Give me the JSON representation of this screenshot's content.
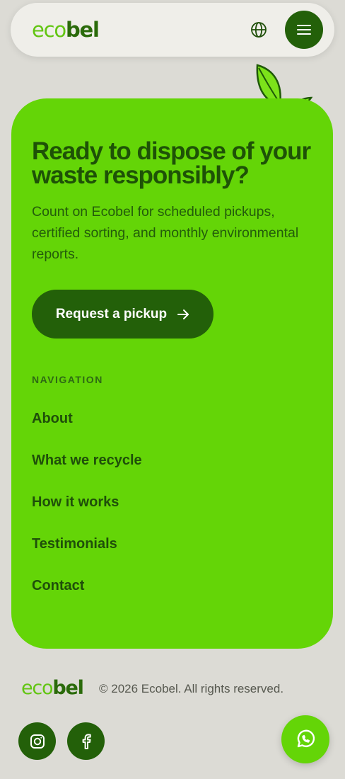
{
  "header": {
    "logo_left": "eco",
    "logo_right": "bel",
    "icons": {
      "language": "globe-icon",
      "menu": "hamburger-icon"
    }
  },
  "cta_section": {
    "title": "Ready to dispose of your waste responsibly?",
    "description": "Count on Ecobel for scheduled pickups, certified sorting, and monthly environmental reports.",
    "button_label": "Request a pickup",
    "button_icon": "arrow-right-icon",
    "decoration_icon": "sprout-icon"
  },
  "navigation": {
    "heading": "NAVIGATION",
    "items": [
      {
        "label": "About"
      },
      {
        "label": "What we recycle"
      },
      {
        "label": "How it works"
      },
      {
        "label": "Testimonials"
      },
      {
        "label": "Contact"
      }
    ]
  },
  "footer": {
    "logo_left": "eco",
    "logo_right": "bel",
    "copyright": "© 2026 Ecobel. All rights reserved.",
    "social": [
      {
        "name": "instagram-icon"
      },
      {
        "name": "facebook-icon"
      }
    ],
    "chat_icon": "whatsapp-icon"
  },
  "colors": {
    "background": "#dcdbd5",
    "accent_green": "#64d507",
    "dark_green": "#236009",
    "header_bg": "#efeee9"
  }
}
